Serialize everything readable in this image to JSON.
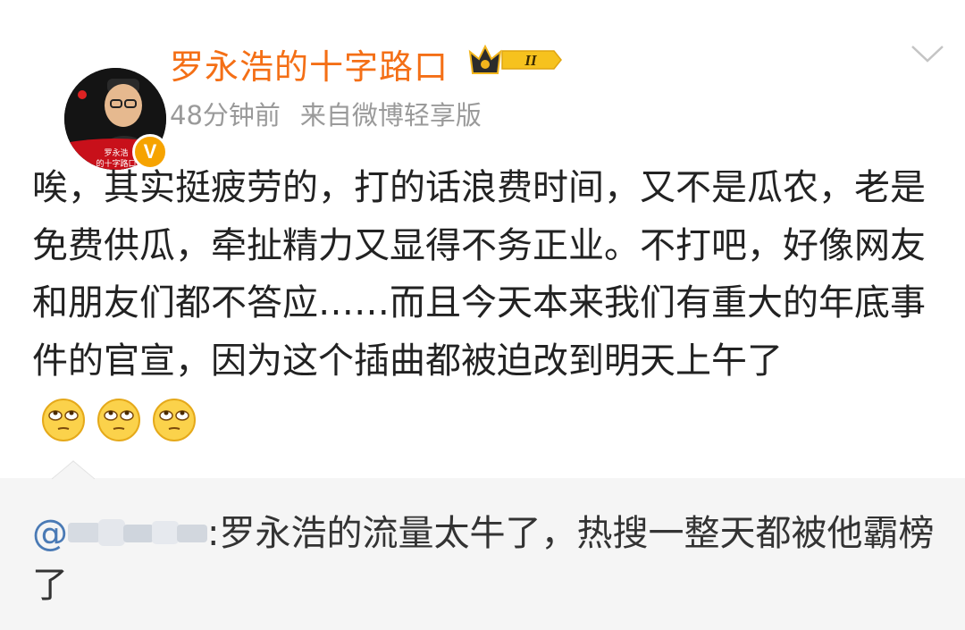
{
  "post": {
    "username": "罗永浩的十字路口",
    "time": "48分钟前",
    "source": "来自微博轻享版",
    "vip_level": "II",
    "verified_badge": "V",
    "text": "唉，其实挺疲劳的，打的话浪费时间，又不是瓜农，老是免费供瓜，牵扯精力又显得不务正业。不打吧，好像网友和朋友们都不答应……而且今天本来我们有重大的年底事件的官宣，因为这个插曲都被迫改到明天上午了",
    "emojis": [
      "eye-roll-emoji",
      "eye-roll-emoji",
      "eye-roll-emoji"
    ]
  },
  "repost": {
    "at_prefix": "@",
    "text": ":罗永浩的流量太牛了，热搜一整天都被他霸榜了"
  },
  "colors": {
    "username": "#f46f16",
    "meta": "#9a9a9a",
    "body": "#222222",
    "repost_bg": "#f5f5f5",
    "verified": "#f6a300"
  }
}
